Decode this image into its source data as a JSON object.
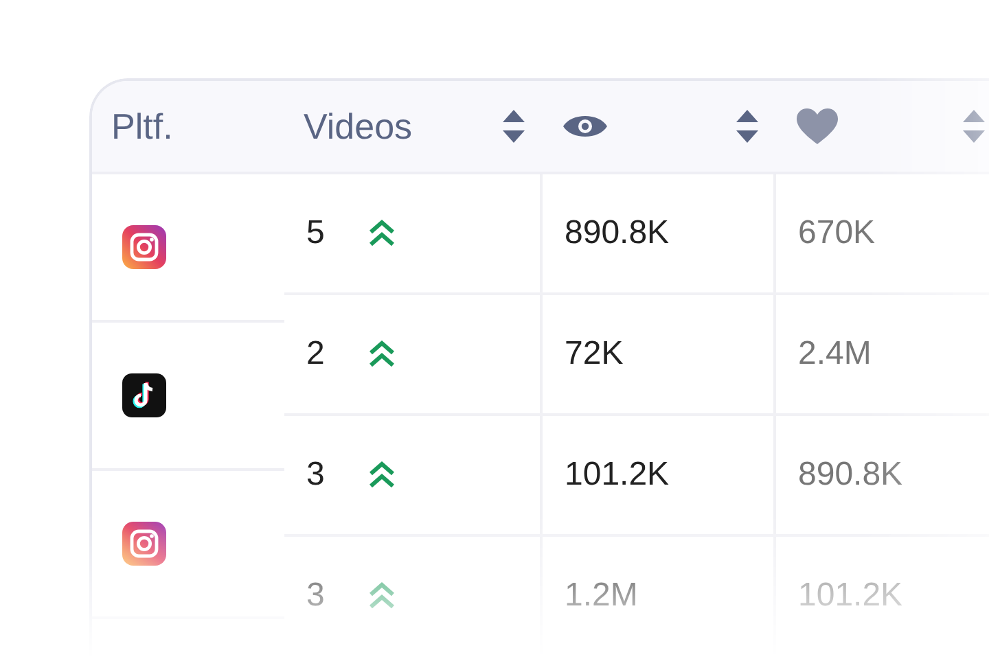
{
  "table": {
    "columns": [
      {
        "kind": "text",
        "label": "Pltf.",
        "sortable": false
      },
      {
        "kind": "text",
        "label": "Videos",
        "sortable": true
      },
      {
        "kind": "views",
        "sortable": true
      },
      {
        "kind": "likes",
        "sortable": true
      }
    ],
    "platforms": [
      {
        "kind": "instagram"
      },
      {
        "kind": "tiktok"
      },
      {
        "kind": "instagram"
      }
    ],
    "rows": [
      {
        "videos": "5",
        "views": "890.8K",
        "likes": "670K"
      },
      {
        "videos": "2",
        "views": "72K",
        "likes": "2.4M"
      },
      {
        "videos": "3",
        "views": "101.2K",
        "likes": "890.8K"
      },
      {
        "videos": "3",
        "views": "1.2M",
        "likes": "101.2K"
      }
    ]
  }
}
